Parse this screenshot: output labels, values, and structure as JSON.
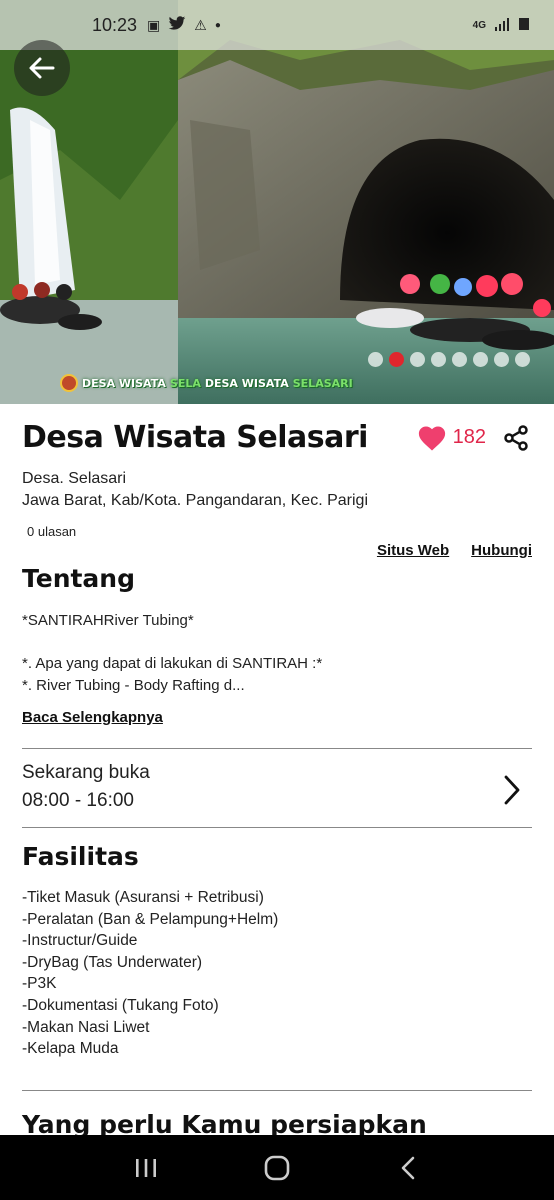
{
  "status_bar": {
    "time": "10:23",
    "network_label": "4G"
  },
  "hero": {
    "watermark_left": "DESA WISATA",
    "watermark_green": "SELA",
    "watermark_right": "DESA WISATA",
    "watermark_right_green": "SELASARI",
    "carousel_count": 8,
    "carousel_active_index": 1
  },
  "place": {
    "title": "Desa Wisata Selasari",
    "likes": "182",
    "address_line1": "Desa. Selasari",
    "address_line2": "Jawa Barat, Kab/Kota. Pangandaran, Kec. Parigi",
    "reviews": "0 ulasan",
    "website_label": "Situs Web",
    "contact_label": "Hubungi"
  },
  "about": {
    "title": "Tentang",
    "text": "*SANTIRAHRiver Tubing*\n\n*. Apa yang dapat di lakukan di SANTIRAH :*\n*. River Tubing - Body Rafting d...",
    "read_more": "Baca Selengkapnya"
  },
  "hours": {
    "status": "Sekarang buka",
    "time": "08:00 - 16:00"
  },
  "facilities": {
    "title": "Fasilitas",
    "items": [
      "-Tiket Masuk (Asuransi + Retribusi)",
      "-Peralatan (Ban & Pelampung+Helm)",
      "-Instructur/Guide",
      "-DryBag (Tas Underwater)",
      "-P3K",
      "-Dokumentasi (Tukang Foto)",
      "-Makan Nasi Liwet",
      "-Kelapa Muda"
    ]
  },
  "next_section": {
    "title": "Yang perlu Kamu persiapkan"
  },
  "colors": {
    "accent_red": "#e0262d",
    "like_pink": "#e0264a"
  },
  "icons": {
    "back": "arrow-left-icon",
    "like": "heart-icon",
    "share": "share-icon",
    "chevron": "chevron-right-icon",
    "nav_recents": "recents-icon",
    "nav_home": "home-icon",
    "nav_back": "nav-back-icon"
  }
}
